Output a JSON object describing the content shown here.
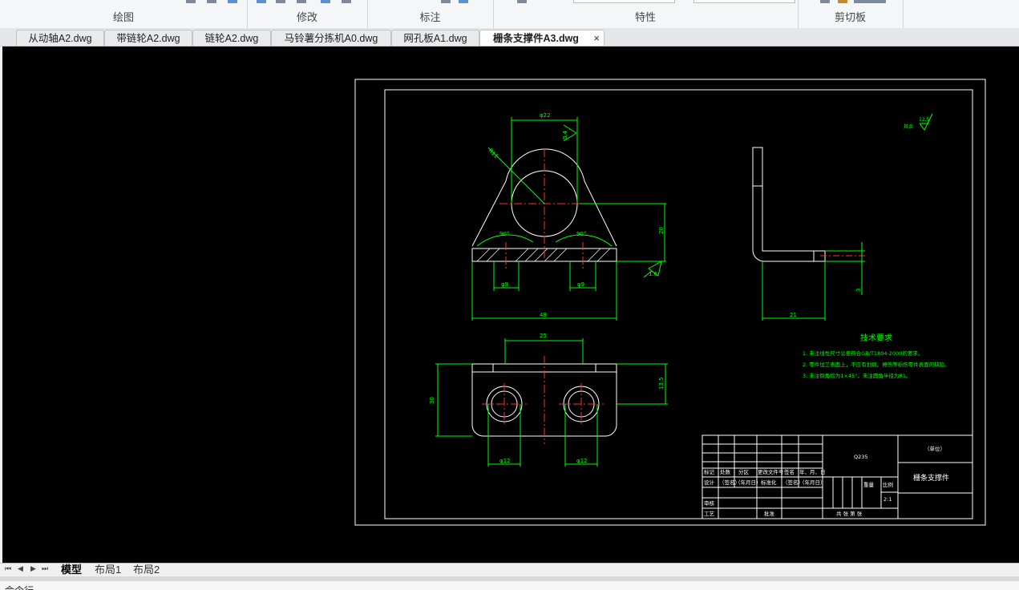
{
  "ribbon": {
    "groups": [
      "绘图",
      "修改",
      "标注",
      "特性",
      "剪切板"
    ]
  },
  "tabs": [
    {
      "label": "从动轴A2.dwg"
    },
    {
      "label": "带链轮A2.dwg"
    },
    {
      "label": "链轮A2.dwg"
    },
    {
      "label": "马铃薯分拣机A0.dwg"
    },
    {
      "label": "网孔板A1.dwg"
    },
    {
      "label": "栅条支撑件A3.dwg",
      "active": true
    }
  ],
  "tab_close_glyph": "×",
  "drawing": {
    "dims": {
      "d22": "φ22",
      "r11": "R11",
      "flatness": "0.4",
      "angle1": "90°",
      "angle2": "90°",
      "h20": "20",
      "thk": "1.6",
      "hole9a": "φ9",
      "hole9b": "φ9",
      "w48": "48",
      "w25": "25",
      "h30": "30",
      "h13": "13.5",
      "hole12a": "φ12",
      "hole12b": "φ12",
      "side21": "21",
      "side3": "3"
    },
    "roughness": {
      "label": "其余",
      "value": "12.5"
    },
    "tech": {
      "title": "技术要求",
      "items": [
        "1. 未注线性尺寸公差符合GB/T1804-2000的要求。",
        "2. 零件加工表面上，不应有划痕、擦伤等损伤零件表面的缺陷。",
        "3. 未注倒角均为1×45°，未注圆角半径为R1。"
      ]
    },
    "title_block": {
      "material": "Q235",
      "unit": "（单位）",
      "part_name": "栅条支撑件",
      "headers_row1": [
        "标记",
        "处数",
        "分区",
        "更改文件号",
        "签名",
        "年、月、日"
      ],
      "headers_row2": [
        "设计",
        "（签名）",
        "（年月日）",
        "标准化",
        "（签名）",
        "（年月日）"
      ],
      "review": "审核",
      "process": "工艺",
      "approve": "批准",
      "weight": "重量",
      "scale_label": "比例",
      "scale": "2:1",
      "sheets": "共  张  第  张"
    }
  },
  "layouts": [
    {
      "label": "模型",
      "active": true
    },
    {
      "label": "布局1"
    },
    {
      "label": "布局2"
    }
  ],
  "command": {
    "prompt": "命令行"
  },
  "colors": {
    "canvas_bg": "#000000",
    "geometry": "#ffffff",
    "dimension": "#00ff00",
    "centerline": "#ff0000",
    "text": "#ffff00"
  }
}
